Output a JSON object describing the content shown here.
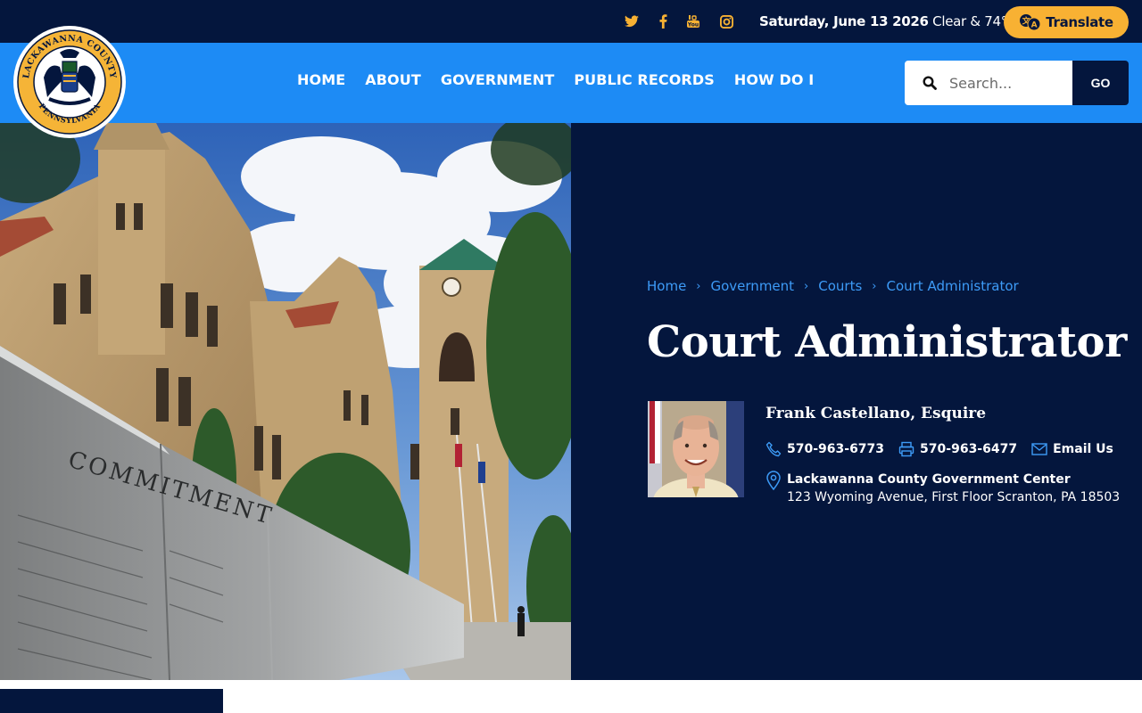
{
  "topbar": {
    "social": [
      "twitter-icon",
      "facebook-icon",
      "youtube-icon",
      "instagram-icon"
    ],
    "date": "Saturday, June 13 2026",
    "weather": "Clear & 74°",
    "translate_label": "Translate"
  },
  "logo": {
    "top_text": "LACKAWANNA COUNTY",
    "bottom_text": "PENNSYLVANIA"
  },
  "nav": {
    "items": [
      "HOME",
      "ABOUT",
      "GOVERNMENT",
      "PUBLIC RECORDS",
      "HOW DO I"
    ]
  },
  "search": {
    "placeholder": "Search...",
    "go_label": "GO"
  },
  "hero": {
    "breadcrumb": [
      "Home",
      "Government",
      "Courts",
      "Court Administrator"
    ],
    "title": "Court Administrator",
    "person": {
      "name": "Frank Castellano, Esquire",
      "phone": "570-963-6773",
      "fax": "570-963-6477",
      "email_label": "Email Us",
      "address_title": "Lackawanna County Government Center",
      "address_line": "123 Wyoming Avenue, First Floor Scranton, PA 18503"
    },
    "memorial_text": "COMMITMENT"
  },
  "colors": {
    "navy": "#04163d",
    "blue": "#1d8bf5",
    "accent": "#f8b133",
    "link": "#3d9bf7"
  }
}
